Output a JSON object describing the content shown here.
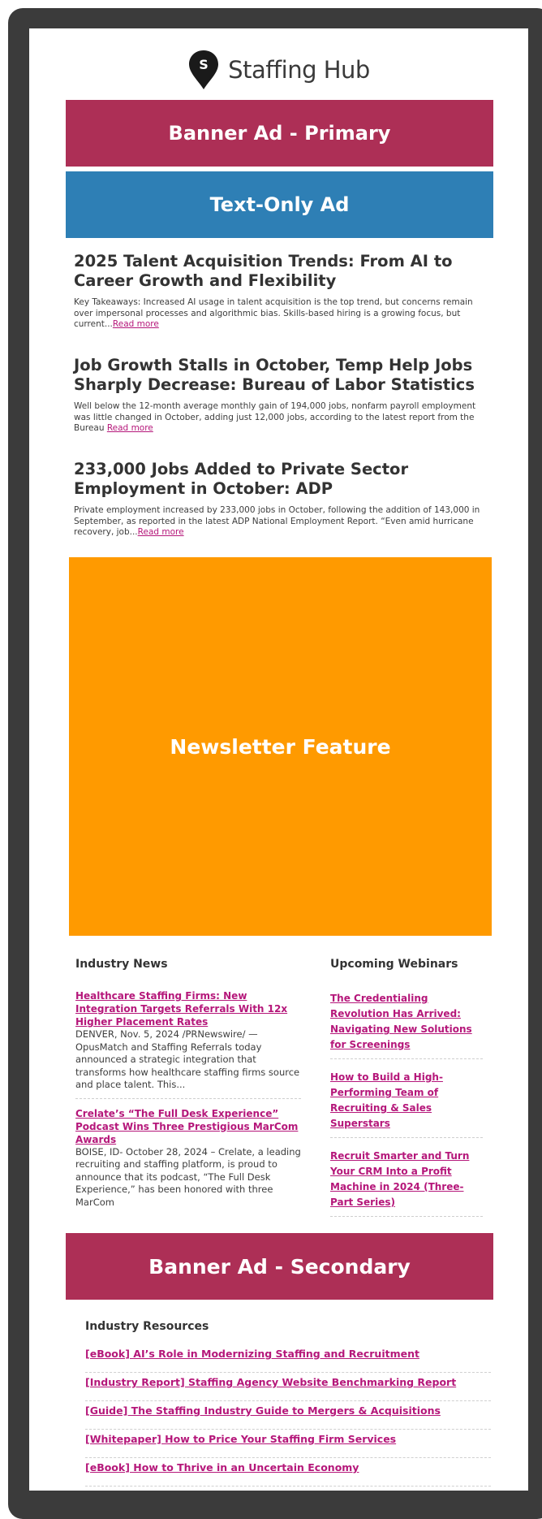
{
  "header": {
    "brand": "Staffing Hub",
    "logo_letter": "S"
  },
  "ads": {
    "primary": "Banner Ad - Primary",
    "text_only": "Text-Only Ad",
    "feature": "Newsletter Feature",
    "secondary": "Banner Ad - Secondary"
  },
  "colors": {
    "banner": "#ad2f56",
    "text_ad": "#2e7fb5",
    "feature": "#ff9a00",
    "link": "#b5177a",
    "frame": "#3b3b3b"
  },
  "articles": [
    {
      "title": "2025 Talent Acquisition Trends: From AI to Career Growth and Flexibility",
      "excerpt": "Key Takeaways: Increased AI usage in talent acquisition is the top trend, but concerns remain over impersonal processes and algorithmic bias. Skills-based hiring is a growing focus, but current...",
      "link": "Read more"
    },
    {
      "title": "Job Growth Stalls in October, Temp Help Jobs Sharply Decrease: Bureau of Labor Statistics",
      "excerpt": "Well below the 12-month average monthly gain of 194,000 jobs, nonfarm payroll employment was little changed in October, adding just 12,000 jobs, according to the latest report from the Bureau ",
      "link": "Read more"
    },
    {
      "title": "233,000 Jobs Added to Private Sector Employment in October: ADP",
      "excerpt": "Private employment increased by 233,000 jobs in October, following the addition of 143,000 in September, as reported in the latest ADP National Employment Report. “Even amid hurricane recovery, job...",
      "link": "Read more"
    }
  ],
  "industry_news": {
    "heading": "Industry News",
    "items": [
      {
        "title": "Healthcare Staffing Firms: New Integration Targets Referrals With 12x Higher Placement Rates",
        "body": "DENVER, Nov. 5, 2024 /PRNewswire/ — OpusMatch and Staffing Referrals today announced a strategic integration that transforms how healthcare staffing firms source and place talent. This..."
      },
      {
        "title": "Crelate’s “The Full Desk Experience” Podcast Wins Three Prestigious MarCom Awards",
        "body": "BOISE, ID- October 28, 2024 – Crelate, a leading recruiting and staffing platform, is proud to announce that its podcast, “The Full Desk Experience,” has been honored with three MarCom"
      }
    ]
  },
  "webinars": {
    "heading": "Upcoming Webinars",
    "items": [
      "The Credentialing Revolution Has Arrived: Navigating New Solutions for Screenings",
      "How to Build a High-Performing Team of Recruiting & Sales Superstars",
      "Recruit Smarter and Turn Your CRM Into a Profit Machine in 2024 (Three-Part Series)"
    ]
  },
  "resources": {
    "heading": "Industry Resources",
    "items": [
      "[eBook] AI’s Role in Modernizing Staffing and Recruitment",
      "[Industry Report] Staffing Agency Website Benchmarking Report",
      "[Guide] The Staffing Industry Guide to Mergers & Acquisitions",
      "[Whitepaper] How to Price Your Staffing Firm Services",
      "[eBook] How to Thrive in an Uncertain Economy"
    ]
  }
}
